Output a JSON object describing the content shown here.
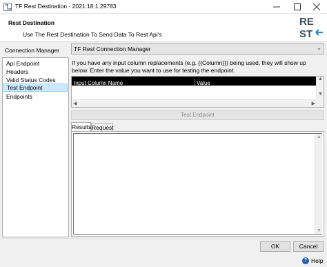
{
  "window": {
    "title": "TF Rest Destination - 2021.18.1.29783",
    "icons": {
      "app": "ssis-component-icon",
      "minimize": "minimize-icon",
      "maximize": "maximize-icon",
      "close": "close-icon"
    }
  },
  "header": {
    "title": "Rest Destination",
    "subtitle": "Use The Rest Destination To Send Data To Rest Api's",
    "logo_text": "REST",
    "logo_colors": {
      "text": "#3d4f5f",
      "arrow": "#2e86c1"
    }
  },
  "connection": {
    "label": "Connection Manager",
    "selected": "TF Rest Connection Manager"
  },
  "nav": {
    "items": [
      {
        "label": "Api Endpoint",
        "selected": false
      },
      {
        "label": "Headers",
        "selected": false
      },
      {
        "label": "Valid Status Codes",
        "selected": false
      },
      {
        "label": "Test Endpoint",
        "selected": true
      },
      {
        "label": "Endpoints",
        "selected": false
      }
    ]
  },
  "main": {
    "description": "If you have any input column replacements (e.g. {{Column}}) being used, they will show up below. Enter the value you want to use for testing the endpoint.",
    "grid": {
      "columns": [
        "Input Column Name",
        "Value"
      ],
      "rows": []
    },
    "test_button": "Test Endpoint",
    "tabs": [
      {
        "label": "Results",
        "active": true
      },
      {
        "label": "Request",
        "active": false
      }
    ],
    "results_text": ""
  },
  "footer": {
    "ok": "OK",
    "cancel": "Cancel",
    "help": "Help",
    "help_icon": "help-circle-icon"
  },
  "colors": {
    "selection_bg": "#cce8ff",
    "selection_border": "#99d1ff",
    "grid_header_bg": "#000000",
    "help_icon": "#1c5dab"
  }
}
